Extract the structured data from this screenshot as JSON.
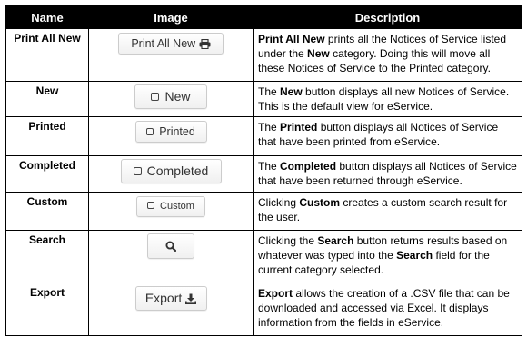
{
  "headers": {
    "name": "Name",
    "image": "Image",
    "description": "Description"
  },
  "rows": [
    {
      "name": "Print All New",
      "button_label": "Print All New",
      "button_icon": "print-icon",
      "desc": [
        {
          "text": "Print All New",
          "bold": true
        },
        {
          "text": " prints all the Notices of Service listed under the ",
          "bold": false
        },
        {
          "text": "New",
          "bold": true
        },
        {
          "text": " category. Doing this will move all these Notices of Service to the Printed category.",
          "bold": false
        }
      ]
    },
    {
      "name": "New",
      "button_label": "New",
      "button_icon": "checkbox-icon",
      "desc": [
        {
          "text": "The ",
          "bold": false
        },
        {
          "text": "New",
          "bold": true
        },
        {
          "text": " button displays all new Notices of Service. This is the default view for eService.",
          "bold": false
        }
      ]
    },
    {
      "name": "Printed",
      "button_label": "Printed",
      "button_icon": "checkbox-icon",
      "desc": [
        {
          "text": "The ",
          "bold": false
        },
        {
          "text": "Printed",
          "bold": true
        },
        {
          "text": " button displays all Notices of Service that have been printed from eService.",
          "bold": false
        }
      ]
    },
    {
      "name": "Completed",
      "button_label": "Completed",
      "button_icon": "checkbox-icon",
      "desc": [
        {
          "text": "The ",
          "bold": false
        },
        {
          "text": "Completed",
          "bold": true
        },
        {
          "text": " button displays all Notices of Service that have been returned through eService.",
          "bold": false
        }
      ]
    },
    {
      "name": "Custom",
      "button_label": "Custom",
      "button_icon": "checkbox-icon",
      "desc": [
        {
          "text": "Clicking ",
          "bold": false
        },
        {
          "text": "Custom",
          "bold": true
        },
        {
          "text": " creates a custom search result for the user.",
          "bold": false
        }
      ]
    },
    {
      "name": "Search",
      "button_label": "",
      "button_icon": "search-icon",
      "desc": [
        {
          "text": "Clicking the ",
          "bold": false
        },
        {
          "text": "Search",
          "bold": true
        },
        {
          "text": " button returns results based on whatever was typed into the ",
          "bold": false
        },
        {
          "text": "Search",
          "bold": true
        },
        {
          "text": " field for the current category selected.",
          "bold": false
        }
      ]
    },
    {
      "name": "Export",
      "button_label": "Export",
      "button_icon": "download-icon",
      "desc": [
        {
          "text": "Export",
          "bold": true
        },
        {
          "text": " allows the creation of a .CSV file that can be downloaded and accessed via Excel. It displays information from the fields in eService.",
          "bold": false
        }
      ]
    }
  ]
}
